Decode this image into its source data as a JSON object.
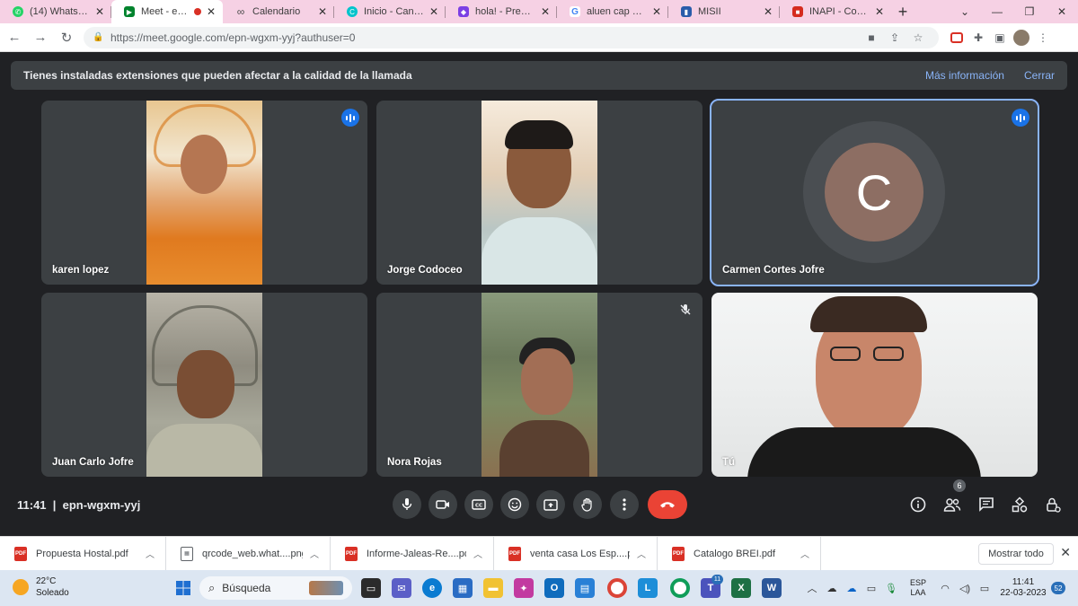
{
  "tabs": [
    {
      "title": "(14) WhatsApp",
      "favicon": "whatsapp-icon",
      "color": "#25d366",
      "active": false
    },
    {
      "title": "Meet - epn-w",
      "favicon": "meet-icon",
      "color": "#00832d",
      "active": true,
      "recording": true
    },
    {
      "title": "Calendario",
      "favicon": "calendar-icon",
      "color": "#4a4a4a",
      "active": false
    },
    {
      "title": "Inicio - Canva",
      "favicon": "canva-icon",
      "color": "#00c4cc",
      "active": false
    },
    {
      "title": "hola! - Presentaci",
      "favicon": "presentation-icon",
      "color": "#7b3fe4",
      "active": false
    },
    {
      "title": "aluen cap chile - ",
      "favicon": "google-icon",
      "color": "#4285f4",
      "active": false
    },
    {
      "title": "MISII",
      "favicon": "misii-icon",
      "color": "#2a5caa",
      "active": false
    },
    {
      "title": "INAPI - Consulta",
      "favicon": "inapi-icon",
      "color": "#d52b1e",
      "active": false
    }
  ],
  "address": {
    "url": "https://meet.google.com/epn-wgxm-yyj?authuser=0"
  },
  "banner": {
    "message": "Tienes instaladas extensiones que pueden afectar a la calidad de la llamada",
    "more": "Más información",
    "close": "Cerrar"
  },
  "participants": [
    {
      "name": "karen lopez",
      "speaking": false,
      "status": "talking"
    },
    {
      "name": "Jorge Codoceo",
      "speaking": false,
      "status": "none"
    },
    {
      "name": "Carmen Cortes Jofre",
      "speaking": true,
      "status": "talking",
      "initial": "C",
      "avatar_color": "#8d6e63"
    },
    {
      "name": "Juan Carlo Jofre",
      "speaking": false,
      "status": "none"
    },
    {
      "name": "Nora Rojas",
      "speaking": false,
      "status": "muted"
    },
    {
      "name": "Tú",
      "speaking": false,
      "status": "none"
    }
  ],
  "meeting": {
    "time": "11:41",
    "code": "epn-wgxm-yyj",
    "participant_count": "6"
  },
  "downloads": [
    {
      "name": "Propuesta Hostal.pdf",
      "type": "pdf"
    },
    {
      "name": "qrcode_web.what....png",
      "type": "png"
    },
    {
      "name": "Informe-Jaleas-Re....pdf",
      "type": "pdf"
    },
    {
      "name": "venta casa Los Esp....pdf",
      "type": "pdf"
    },
    {
      "name": "Catalogo BREI.pdf",
      "type": "pdf"
    }
  ],
  "downloads_show_all": "Mostrar todo",
  "taskbar": {
    "temp": "22°C",
    "weather": "Soleado",
    "search_placeholder": "Búsqueda",
    "teams_badge": "11",
    "lang1": "ESP",
    "lang2": "LAA",
    "time": "11:41",
    "date": "22-03-2023",
    "notifications": "52"
  }
}
